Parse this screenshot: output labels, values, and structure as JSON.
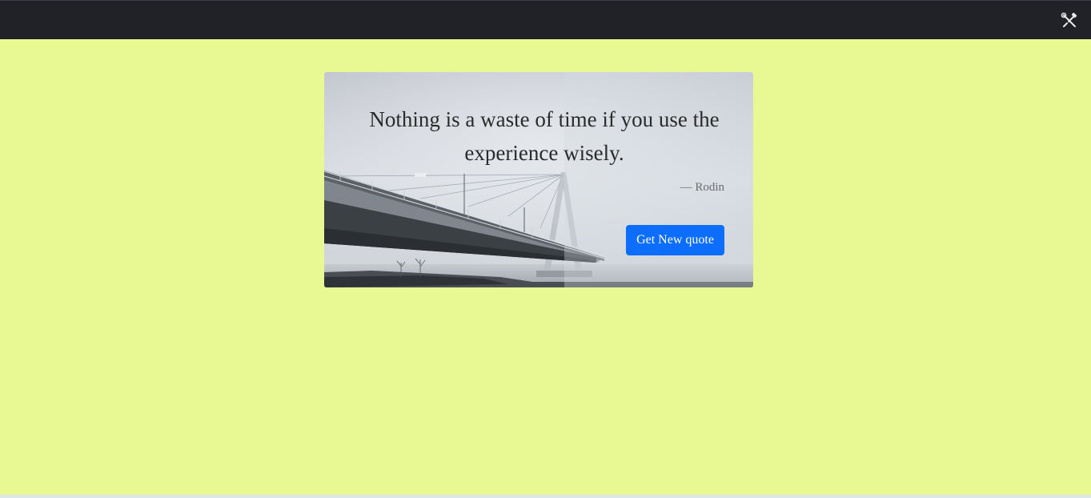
{
  "topbar": {
    "tools_icon": "tools-icon",
    "background": "#202228"
  },
  "page": {
    "background": "#e8f993"
  },
  "quote_card": {
    "background_image": "foggy-bridge-photo",
    "quote_text": "Nothing is a waste of time if you use the experience wisely.",
    "author": "— Rodin",
    "button_label": "Get New quote",
    "button_color": "#0d6efd"
  }
}
